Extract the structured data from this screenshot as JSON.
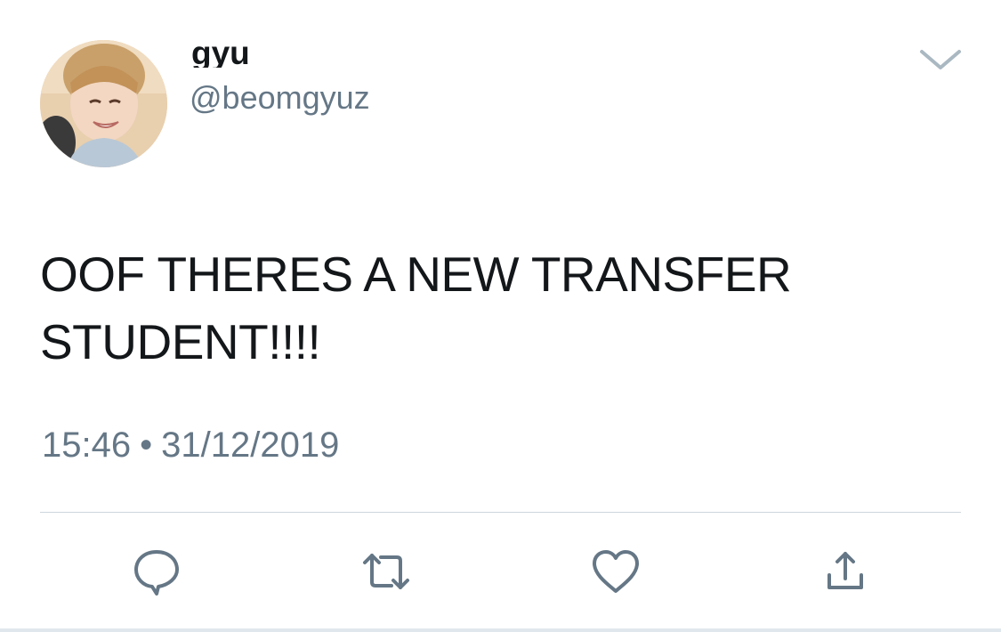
{
  "user": {
    "display_name": "gyu",
    "handle": "@beomgyuz",
    "avatar_icon": "profile-photo"
  },
  "tweet": {
    "text_lines": [
      "OOF THERES A NEW TRANSFER",
      "STUDENT!!!!"
    ],
    "time": "15:46",
    "separator": "•",
    "date": "31/12/2019"
  },
  "actions": {
    "reply_icon": "reply-icon",
    "retweet_icon": "retweet-icon",
    "like_icon": "heart-icon",
    "share_icon": "share-icon"
  },
  "colors": {
    "text": "#14171a",
    "secondary": "#657786",
    "icon": "#657786",
    "divider": "#ccd6dd"
  }
}
